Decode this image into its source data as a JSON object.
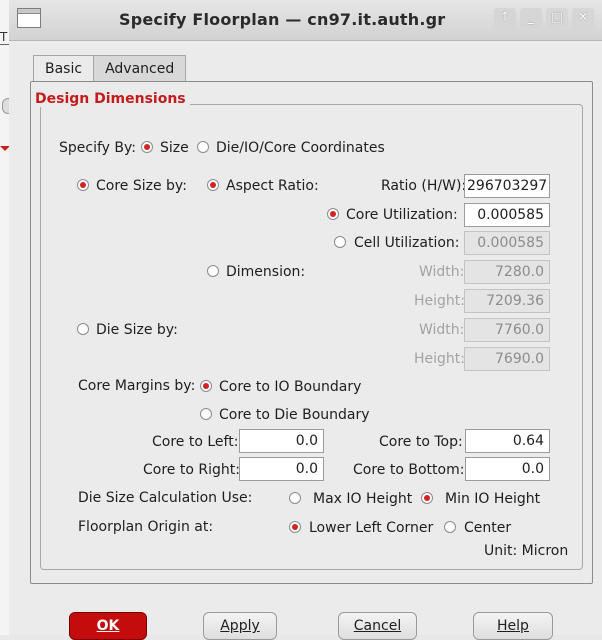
{
  "background": {
    "fragment_text": "T"
  },
  "window": {
    "title": "Specify Floorplan — cn97.it.auth.gr",
    "controls": {
      "up": "↑",
      "minimize": "_",
      "maximize": "□",
      "close": "✕"
    }
  },
  "tabs": [
    {
      "label": "Basic",
      "active": true
    },
    {
      "label": "Advanced",
      "active": false
    }
  ],
  "group": {
    "title": "Design Dimensions",
    "title_color": "#c41c1c"
  },
  "specify_by": {
    "label": "Specify By:",
    "options": {
      "size": "Size",
      "coords": "Die/IO/Core Coordinates"
    },
    "selected": "size"
  },
  "core_size": {
    "label": "Core Size by:",
    "aspect_ratio": {
      "label": "Aspect Ratio:",
      "ratio_label": "Ratio (H/W):",
      "ratio_value": "296703297"
    },
    "core_util": {
      "label": "Core Utilization:",
      "value": "0.000585"
    },
    "cell_util": {
      "label": "Cell Utilization:",
      "value": "0.000585"
    },
    "dimension": {
      "label": "Dimension:",
      "width_label": "Width:",
      "width_value": "7280.0",
      "height_label": "Height:",
      "height_value": "7209.36"
    }
  },
  "die_size": {
    "label": "Die Size by:",
    "width_label": "Width:",
    "width_value": "7760.0",
    "height_label": "Height:",
    "height_value": "7690.0"
  },
  "core_margins": {
    "label": "Core Margins by:",
    "io": "Core to IO Boundary",
    "die": "Core to Die Boundary"
  },
  "margins": {
    "left_label": "Core to Left:",
    "left": "0.0",
    "right_label": "Core to Right:",
    "right": "0.0",
    "top_label": "Core to Top:",
    "top": "0.64",
    "bottom_label": "Core to Bottom:",
    "bottom": "0.0"
  },
  "die_calc": {
    "label": "Die Size Calculation Use:",
    "max": "Max IO Height",
    "min": "Min IO Height",
    "selected": "min"
  },
  "origin": {
    "label": "Floorplan Origin at:",
    "lower_left": "Lower Left Corner",
    "center": "Center",
    "selected": "lower_left"
  },
  "unit": "Unit: Micron",
  "buttons": {
    "ok": "OK",
    "apply": "Apply",
    "cancel": "Cancel",
    "help": "Help"
  },
  "colors": {
    "accent_red": "#d42222",
    "ok_button": "#c40c0c"
  }
}
